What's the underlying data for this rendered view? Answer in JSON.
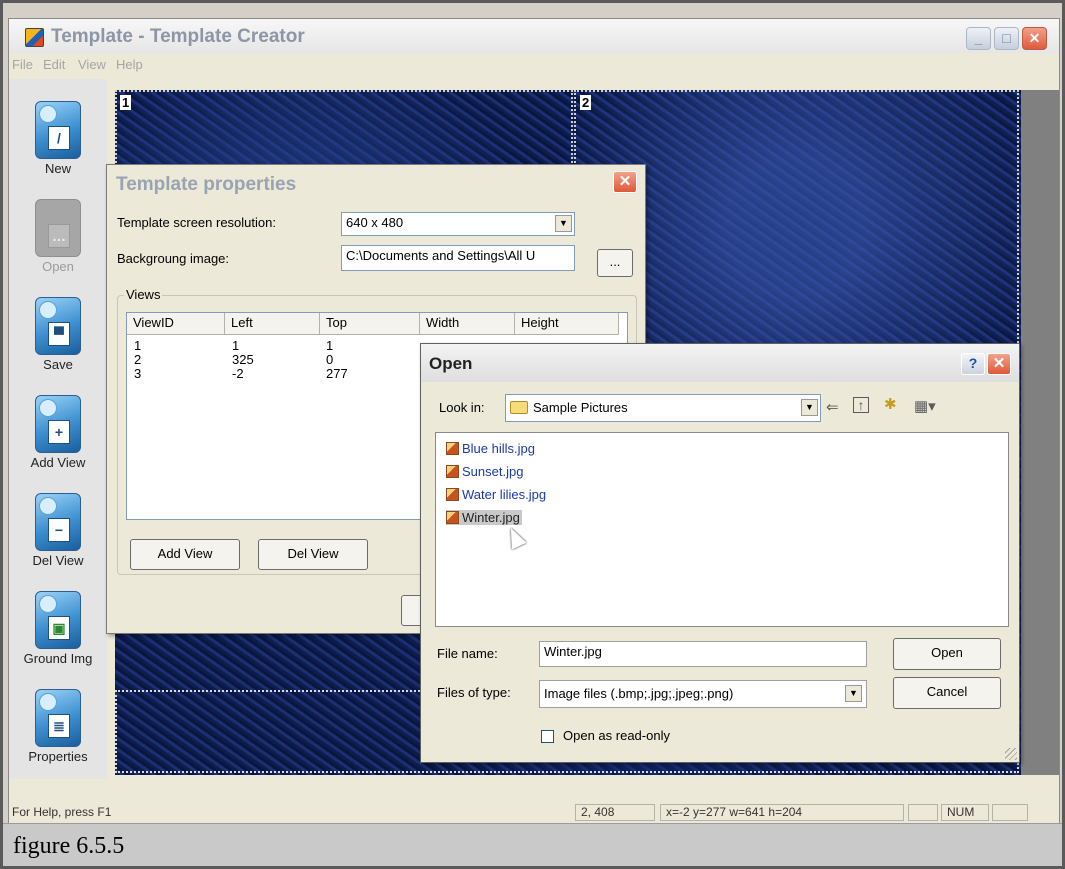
{
  "main_window": {
    "title": "Template - Template Creator",
    "menu": [
      "File",
      "Edit",
      "View",
      "Help"
    ],
    "controls": {
      "minimize": "_",
      "maximize": "□",
      "close": "✕"
    }
  },
  "toolbar": {
    "items": [
      {
        "label": "New",
        "icon": "new-icon",
        "enabled": true,
        "glyph": "/"
      },
      {
        "label": "Open",
        "icon": "open-icon",
        "enabled": false,
        "glyph": "…"
      },
      {
        "label": "Save",
        "icon": "save-icon",
        "enabled": true,
        "glyph": "▀"
      },
      {
        "label": "Add View",
        "icon": "add-view-icon",
        "enabled": true,
        "glyph": "+"
      },
      {
        "label": "Del View",
        "icon": "del-view-icon",
        "enabled": true,
        "glyph": "−"
      },
      {
        "label": "Ground Img",
        "icon": "ground-image-icon",
        "enabled": true,
        "glyph": "▣"
      },
      {
        "label": "Properties",
        "icon": "properties-icon",
        "enabled": true,
        "glyph": "≣"
      }
    ]
  },
  "canvas": {
    "view_labels": [
      "1",
      "2"
    ]
  },
  "status_bar": {
    "help": "For Help, press F1",
    "pos": "2, 408",
    "view_info": "x=-2 y=277 w=641 h=204",
    "num": "NUM"
  },
  "template_properties": {
    "title": "Template properties",
    "resolution_label": "Template screen resolution:",
    "resolution_value": "640 x 480",
    "background_label": "Backgroung image:",
    "background_value": "C:\\Documents and Settings\\All U",
    "browse_label": "...",
    "views_group": "Views",
    "columns": [
      "ViewID",
      "Left",
      "Top",
      "Width",
      "Height"
    ],
    "rows": [
      [
        "1",
        "1",
        "1"
      ],
      [
        "2",
        "325",
        "0"
      ],
      [
        "3",
        "-2",
        "277"
      ]
    ],
    "add_view_button": "Add View",
    "del_view_button": "Del View"
  },
  "open_dialog": {
    "title": "Open",
    "help_button": "?",
    "look_in_label": "Look in:",
    "look_in_value": "Sample Pictures",
    "files": [
      "Blue hills.jpg",
      "Sunset.jpg",
      "Water lilies.jpg",
      "Winter.jpg"
    ],
    "selected_file": "Winter.jpg",
    "file_name_label": "File name:",
    "file_name_value": "Winter.jpg",
    "files_of_type_label": "Files of type:",
    "files_of_type_value": "Image files (.bmp;.jpg;.jpeg;.png)",
    "open_button": "Open",
    "cancel_button": "Cancel",
    "read_only_label": "Open as read-only"
  },
  "caption": "figure 6.5.5"
}
